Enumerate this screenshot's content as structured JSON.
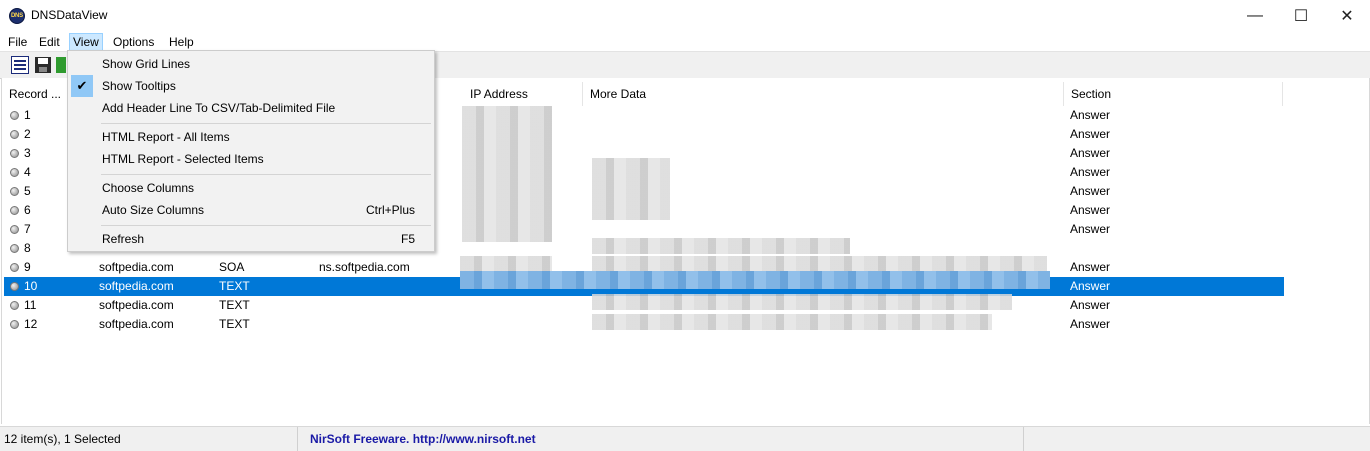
{
  "window": {
    "title": "DNSDataView",
    "icon": "dns-app-icon",
    "min_glyph": "—",
    "max_glyph": "☐",
    "close_glyph": "✕"
  },
  "menu": [
    "File",
    "Edit",
    "View",
    "Options",
    "Help"
  ],
  "view_menu": {
    "items": [
      {
        "label": "Show Grid Lines",
        "shortcut": "",
        "checked": false
      },
      {
        "label": "Show Tooltips",
        "shortcut": "",
        "checked": true
      },
      {
        "label": "Add Header Line To CSV/Tab-Delimited File",
        "shortcut": "",
        "checked": false
      },
      {
        "label": "HTML Report - All Items",
        "shortcut": "",
        "checked": false
      },
      {
        "label": "HTML Report - Selected Items",
        "shortcut": "",
        "checked": false
      },
      {
        "label": "Choose Columns",
        "shortcut": "",
        "checked": false
      },
      {
        "label": "Auto Size Columns",
        "shortcut": "Ctrl+Plus",
        "checked": false
      },
      {
        "label": "Refresh",
        "shortcut": "F5",
        "checked": false
      }
    ],
    "check_glyph": "✔"
  },
  "columns": {
    "record": "Record ...",
    "ip": "IP Address",
    "more": "More Data",
    "section": "Section"
  },
  "rows": [
    {
      "num": "1",
      "host": "",
      "type": "",
      "data": "",
      "section": "Answer"
    },
    {
      "num": "2",
      "host": "",
      "type": "",
      "data": "",
      "section": "Answer"
    },
    {
      "num": "3",
      "host": "",
      "type": "",
      "data": "",
      "section": "Answer"
    },
    {
      "num": "4",
      "host": "",
      "type": "",
      "data": "",
      "section": "Answer"
    },
    {
      "num": "5",
      "host": "",
      "type": "",
      "data": "",
      "section": "Answer"
    },
    {
      "num": "6",
      "host": "",
      "type": "",
      "data": "",
      "section": "Answer"
    },
    {
      "num": "7",
      "host": "",
      "type": "",
      "data": "",
      "section": "Answer"
    },
    {
      "num": "8",
      "host": "",
      "type": "",
      "data": "",
      "section": ""
    },
    {
      "num": "9",
      "host": "softpedia.com",
      "type": "SOA",
      "data": "ns.softpedia.com",
      "section": "Answer"
    },
    {
      "num": "10",
      "host": "softpedia.com",
      "type": "TEXT",
      "data": "",
      "section": "Answer"
    },
    {
      "num": "11",
      "host": "softpedia.com",
      "type": "TEXT",
      "data": "",
      "section": "Answer"
    },
    {
      "num": "12",
      "host": "softpedia.com",
      "type": "TEXT",
      "data": "",
      "section": "Answer"
    }
  ],
  "selected_row": "10",
  "status": {
    "count": "12 item(s), 1 Selected",
    "freeware": "NirSoft Freeware.  http://www.nirsoft.net"
  },
  "colors": {
    "selection": "#0078d7",
    "menu_highlight": "#cce8ff",
    "link": "#1a1aa6"
  }
}
